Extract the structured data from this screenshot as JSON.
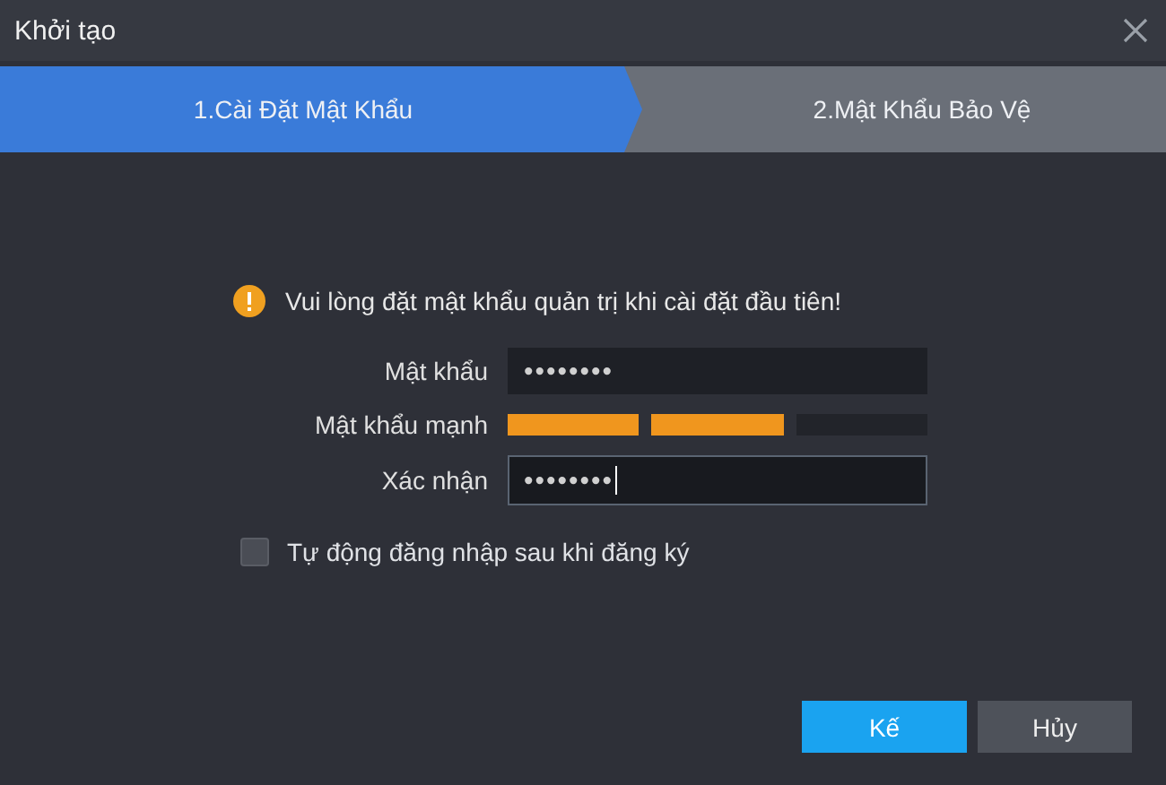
{
  "window": {
    "title": "Khởi tạo"
  },
  "steps": [
    {
      "label": "1.Cài Đặt Mật Khẩu",
      "selected": true
    },
    {
      "label": "2.Mật Khẩu Bảo Vệ",
      "selected": false
    }
  ],
  "notice": "Vui lòng đặt mật khẩu quản trị khi cài đặt đầu tiên!",
  "fields": [
    {
      "kind": "password",
      "label": "Mật khẩu",
      "value": "••••••••",
      "focused": false
    },
    {
      "kind": "strength",
      "label": "Mật khẩu mạnh",
      "segments": [
        {
          "filled": true
        },
        {
          "filled": true
        },
        {
          "filled": false
        }
      ]
    },
    {
      "kind": "password",
      "label": "Xác nhận",
      "value": "••••••••",
      "focused": true
    }
  ],
  "auto_login": {
    "label": "Tự động đăng nhập sau khi đăng ký",
    "checked": false
  },
  "buttons": [
    {
      "label": "Kế",
      "primary": true
    },
    {
      "label": "Hủy",
      "primary": false
    }
  ]
}
